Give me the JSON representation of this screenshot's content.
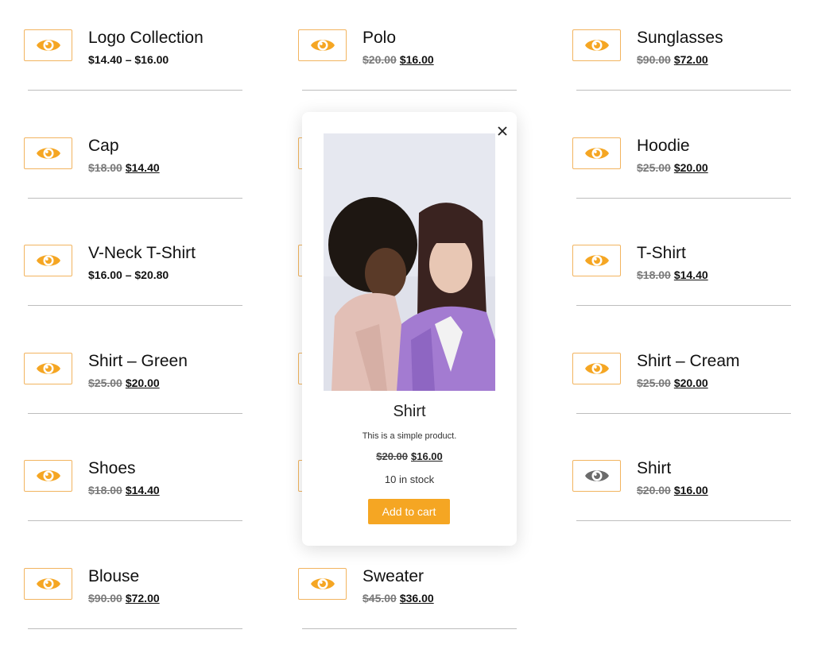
{
  "colors": {
    "accent": "#f5a623",
    "eye_active": "#6b6b6b",
    "divider": "#bdbdbd"
  },
  "products": [
    {
      "name": "Logo Collection",
      "price_type": "range",
      "price": "$14.40 – $16.00",
      "icon": "eye-icon"
    },
    {
      "name": "Polo",
      "price_type": "sale",
      "old": "$20.00",
      "new": "$16.00",
      "icon": "eye-icon"
    },
    {
      "name": "Sunglasses",
      "price_type": "sale",
      "old": "$90.00",
      "new": "$72.00",
      "icon": "eye-icon"
    },
    {
      "name": "Cap",
      "price_type": "sale",
      "old": "$18.00",
      "new": "$14.40",
      "icon": "eye-icon"
    },
    {
      "name": "Hoodie",
      "price_type": "sale",
      "old": "$25.00",
      "new": "$20.00",
      "icon": "eye-icon"
    },
    {
      "name": "V-Neck T-Shirt",
      "price_type": "range",
      "price": "$16.00 – $20.80",
      "icon": "eye-icon"
    },
    {
      "name": "T-Shirt",
      "price_type": "sale",
      "old": "$18.00",
      "new": "$14.40",
      "icon": "eye-icon"
    },
    {
      "name": "Shirt – Green",
      "price_type": "sale",
      "old": "$25.00",
      "new": "$20.00",
      "icon": "eye-icon"
    },
    {
      "name": "Shirt – Cream",
      "price_type": "sale",
      "old": "$25.00",
      "new": "$20.00",
      "icon": "eye-icon"
    },
    {
      "name": "Shoes",
      "price_type": "sale",
      "old": "$18.00",
      "new": "$14.40",
      "icon": "eye-icon"
    },
    {
      "name": "Shirt",
      "price_type": "sale",
      "old": "$20.00",
      "new": "$16.00",
      "icon": "eye-icon",
      "active": true
    },
    {
      "name": "Blouse",
      "price_type": "sale",
      "old": "$90.00",
      "new": "$72.00",
      "icon": "eye-icon"
    },
    {
      "name": "Sweater",
      "price_type": "sale",
      "old": "$45.00",
      "new": "$36.00",
      "icon": "eye-icon"
    }
  ],
  "modal": {
    "title": "Shirt",
    "description": "This is a simple product.",
    "old_price": "$20.00",
    "new_price": "$16.00",
    "stock": "10 in stock",
    "button": "Add to cart",
    "close_icon": "close-icon"
  }
}
